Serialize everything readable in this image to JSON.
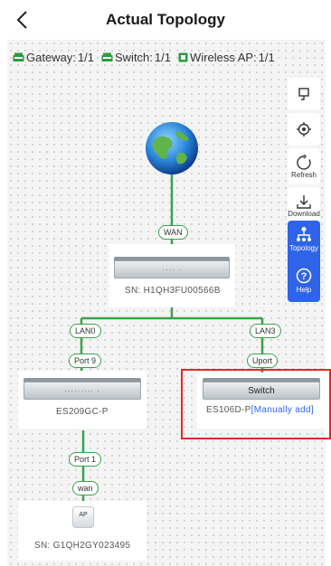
{
  "header": {
    "title": "Actual Topology",
    "back_icon": "chevron-left-icon"
  },
  "stats": [
    {
      "label": "Gateway:",
      "value": "1/1",
      "icon": "gateway-icon"
    },
    {
      "label": "Switch:",
      "value": "1/1",
      "icon": "switch-icon"
    },
    {
      "label": "Wireless AP:",
      "value": "1/1",
      "icon": "wireless-ap-icon"
    }
  ],
  "colors": {
    "link": "#3aa34a",
    "accent": "#2f64e8",
    "highlight": "#e02a2a"
  },
  "topology": {
    "internet_icon": "globe-icon",
    "wan_tag": "WAN",
    "gateway": {
      "sn": "SN:  H1QH3FU00566B"
    },
    "lan0_tag": "LAN0",
    "lan3_tag": "LAN3",
    "left_switch": {
      "port_tag": "Port 9",
      "model": "ES209GC-P"
    },
    "right_switch": {
      "port_tag": "Uport",
      "label": "Switch",
      "model": "ES106D-P",
      "manual": "[Manually add]"
    },
    "ap": {
      "port_tag": "Port 1",
      "uplink_tag": "wan",
      "label": "AP",
      "sn": "SN:  G1QH2GY023495"
    }
  },
  "sidebar": {
    "tools": [
      {
        "icon": "minimize-icon",
        "label": ""
      },
      {
        "icon": "locate-icon",
        "label": ""
      },
      {
        "icon": "refresh-icon",
        "label": "Refresh"
      },
      {
        "icon": "download-icon",
        "label": "Download"
      }
    ],
    "topology_label": "Topology",
    "help_label": "Help"
  }
}
